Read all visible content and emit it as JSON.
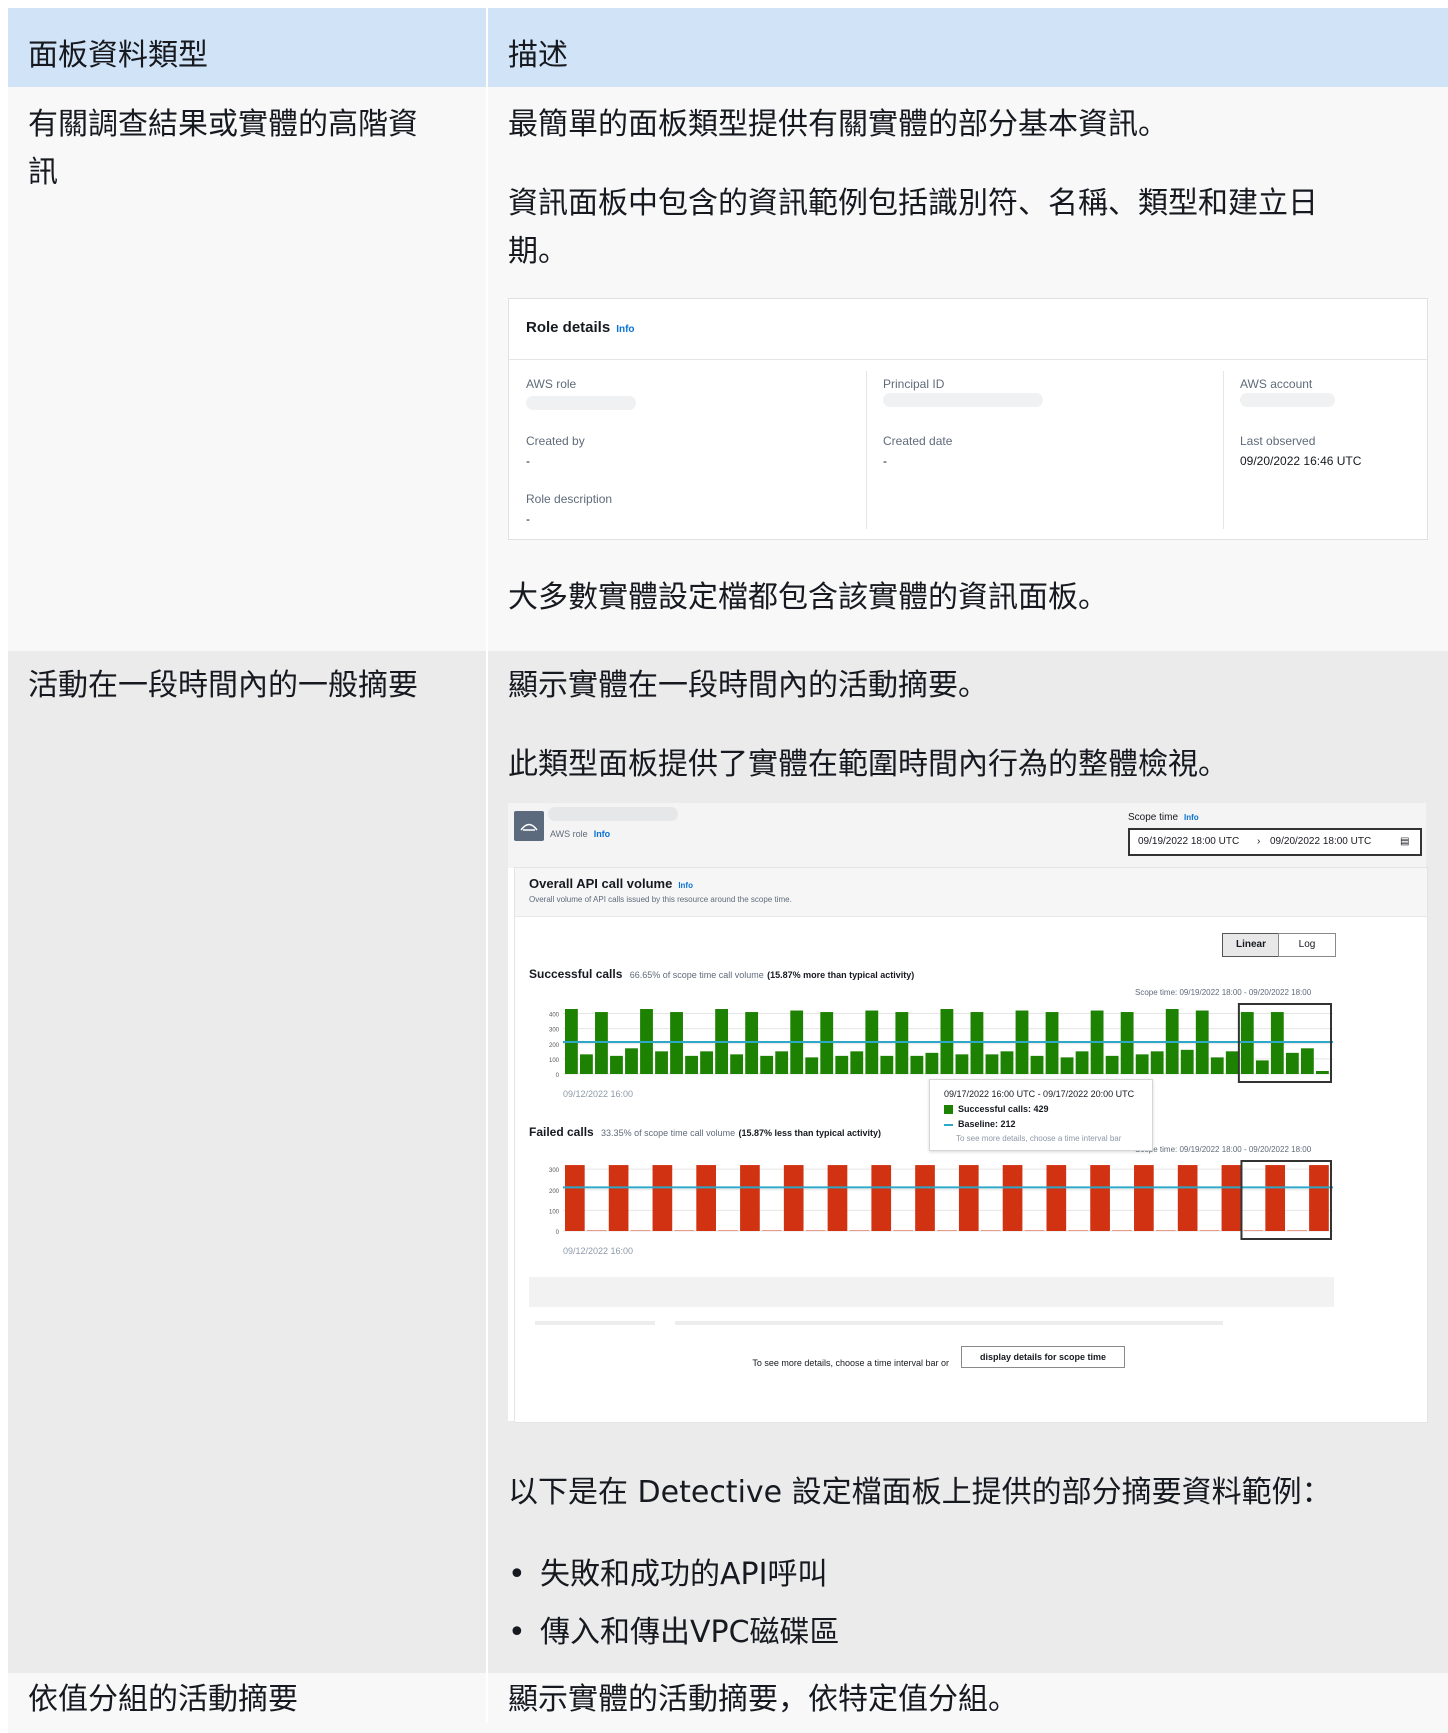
{
  "header": {
    "col1": "面板資料類型",
    "col2": "描述"
  },
  "rows": [
    {
      "label_line1": "有關調查結果或實體的高階資",
      "label_line2": "訊",
      "p1": "最簡單的面板類型提供有關實體的部分基本資訊。",
      "p2_line1": "資訊面板中包含的資訊範例包括識別符、名稱、類型和建立日",
      "p2_line2": "期。",
      "p3": "大多數實體設定檔都包含該實體的資訊面板。"
    },
    {
      "label": "活動在一段時間內的一般摘要",
      "p1": "顯示實體在一段時間內的活動摘要。",
      "p2": "此類型面板提供了實體在範圍時間內行為的整體檢視。",
      "p3": "以下是在 Detective 設定檔面板上提供的部分摘要資料範例：",
      "bullets": [
        "失敗和成功的API呼叫",
        "傳入和傳出VPC磁碟區"
      ]
    },
    {
      "label": "依值分組的活動摘要",
      "p1": "顯示實體的活動摘要，依特定值分組。"
    }
  ],
  "role_card": {
    "title": "Role details",
    "info": "Info",
    "fields": {
      "aws_role": "AWS role",
      "principal_id": "Principal ID",
      "aws_account": "AWS account",
      "created_by": "Created by",
      "created_by_value": "-",
      "created_date": "Created date",
      "created_date_value": "-",
      "last_observed": "Last observed",
      "last_observed_value": "09/20/2022 16:46 UTC",
      "role_description": "Role description",
      "role_description_value": "-"
    }
  },
  "activity_card": {
    "entity_type": "AWS role",
    "info": "Info",
    "scope_label": "Scope time",
    "scope_start": "09/19/2022 18:00 UTC",
    "scope_end": "09/20/2022 18:00 UTC",
    "panel_title": "Overall API call volume",
    "panel_subtitle": "Overall volume of API calls issued by this resource around the scope time.",
    "linear": "Linear",
    "log": "Log",
    "successful_title": "Successful calls",
    "successful_stat": "66.65% of scope time call volume",
    "successful_compare": "(15.87% more than typical activity)",
    "failed_title": "Failed calls",
    "failed_stat": "33.35% of scope time call volume",
    "failed_compare": "(15.87% less than typical activity)",
    "scope_range_label": "Scope time: 09/19/2022 18:00 - 09/20/2022 18:00",
    "x_start_label": "09/12/2022 16:00",
    "tooltip": {
      "range": "09/17/2022 16:00 UTC - 09/17/2022 20:00 UTC",
      "successful": "Successful calls: 429",
      "baseline": "Baseline: 212",
      "hint": "To see more details, choose a time interval bar"
    },
    "footer_hint": "To see more details, choose a time interval bar or",
    "footer_button": "display details for scope time"
  },
  "chart_data": [
    {
      "type": "bar",
      "title": "Successful calls",
      "y_ticks": [
        0,
        100,
        200,
        300,
        400
      ],
      "ylim": [
        0,
        450
      ],
      "baseline": 212,
      "color": "#1d8102",
      "values": [
        430,
        130,
        410,
        120,
        170,
        430,
        150,
        410,
        120,
        150,
        430,
        130,
        410,
        120,
        150,
        420,
        110,
        410,
        120,
        150,
        420,
        120,
        410,
        120,
        140,
        430,
        130,
        410,
        130,
        150,
        420,
        120,
        410,
        110,
        150,
        420,
        120,
        410,
        130,
        150,
        430,
        160,
        420,
        110,
        150,
        410,
        90,
        410,
        140,
        170,
        20
      ],
      "highlight_from_index": 45
    },
    {
      "type": "bar",
      "title": "Failed calls",
      "y_ticks": [
        0,
        100,
        200,
        300
      ],
      "ylim": [
        0,
        330
      ],
      "baseline": 212,
      "color": "#d13212",
      "values": [
        320,
        0,
        320,
        0,
        320,
        0,
        320,
        0,
        320,
        0,
        320,
        0,
        320,
        0,
        320,
        0,
        320,
        0,
        320,
        0,
        320,
        0,
        320,
        0,
        320,
        0,
        320,
        0,
        320,
        0,
        320,
        0,
        320,
        0,
        320
      ],
      "highlight_from_index": 31
    }
  ]
}
